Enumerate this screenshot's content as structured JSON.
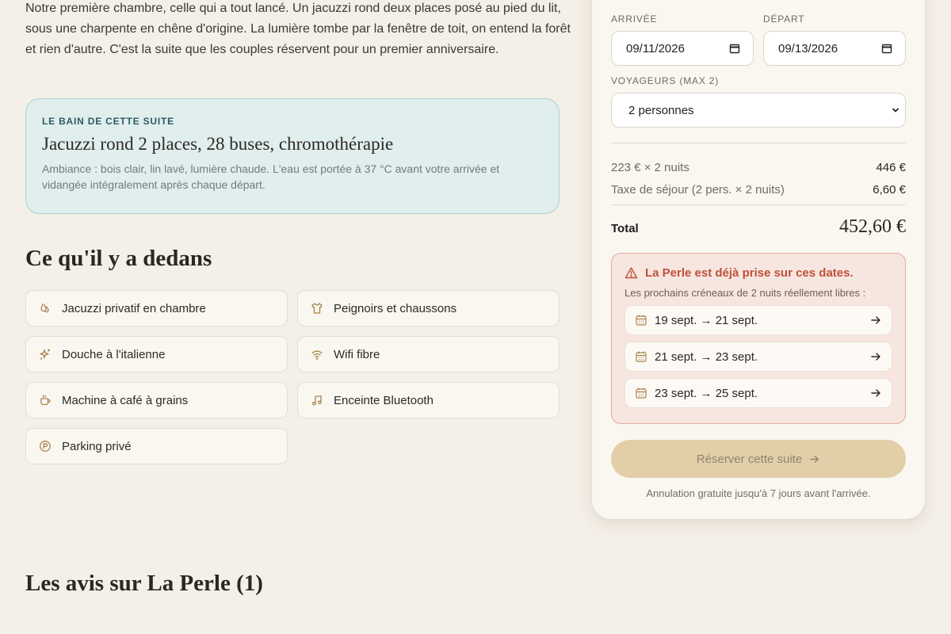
{
  "intro": {
    "text": "Notre première chambre, celle qui a tout lancé. Un jacuzzi rond deux places posé au pied du lit, sous une charpente en chêne d'origine. La lumière tombe par la fenêtre de toit, on entend la forêt et rien d'autre. C'est la suite que les couples réservent pour un premier anniversaire."
  },
  "bath": {
    "eyebrow": "LE BAIN DE CETTE SUITE",
    "title": "Jacuzzi rond 2 places, 28 buses, chromothérapie",
    "description": "Ambiance : bois clair, lin lavé, lumière chaude. L'eau est portée à 37 °C avant votre arrivée et vidangée intégralement après chaque départ."
  },
  "amenities": {
    "heading": "Ce qu'il y a dedans",
    "items": [
      {
        "label": "Jacuzzi privatif en chambre",
        "icon": "droplets-icon"
      },
      {
        "label": "Peignoirs et chaussons",
        "icon": "shirt-icon"
      },
      {
        "label": "Douche à l'italienne",
        "icon": "sparkles-icon"
      },
      {
        "label": "Wifi fibre",
        "icon": "wifi-icon"
      },
      {
        "label": "Machine à café à grains",
        "icon": "coffee-icon"
      },
      {
        "label": "Enceinte Bluetooth",
        "icon": "music-icon"
      },
      {
        "label": "Parking privé",
        "icon": "parking-icon"
      }
    ]
  },
  "reviews": {
    "heading": "Les avis sur La Perle (1)"
  },
  "booking": {
    "arrival_label": "ARRIVÉE",
    "arrival_value": "09/11/2026",
    "departure_label": "DÉPART",
    "departure_value": "09/13/2026",
    "guests_label": "VOYAGEURS (MAX 2)",
    "guests_value": "2 personnes",
    "price_lines": [
      {
        "label": "223 € × 2 nuits",
        "value": "446 €"
      },
      {
        "label": "Taxe de séjour (2 pers. × 2 nuits)",
        "value": "6,60 €"
      }
    ],
    "total_label": "Total",
    "total_value": "452,60 €",
    "alert": {
      "title": "La Perle est déjà prise sur ces dates.",
      "subtitle": "Les prochains créneaux de 2 nuits réellement libres :",
      "slots": [
        {
          "label": "19 sept. → 21 sept."
        },
        {
          "label": "21 sept. → 23 sept."
        },
        {
          "label": "23 sept. → 25 sept."
        }
      ]
    },
    "reserve_label": "Réserver cette suite",
    "cancel_note": "Annulation gratuite jusqu'à 7 jours avant l'arrivée."
  },
  "colors": {
    "background": "#f4efe7",
    "accent_gold": "#a8854e",
    "alert_red": "#c0503a",
    "bath_teal_bg": "#e0eeed",
    "button_disabled": "#e2cfa8"
  }
}
